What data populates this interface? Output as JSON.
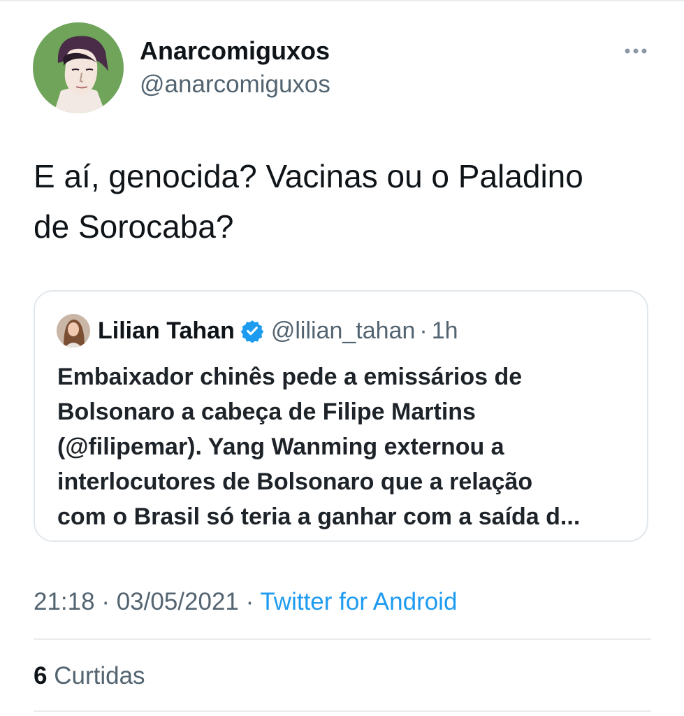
{
  "author": {
    "display_name": "Anarcomiguxos",
    "handle": "@anarcomiguxos",
    "avatar_icon": "user-avatar-icon"
  },
  "tweet": {
    "text_line1": "E aí, genocida? Vacinas ou o Paladino",
    "text_line2": "de Sorocaba?"
  },
  "quoted_tweet": {
    "display_name": "Lilian Tahan",
    "verified": true,
    "handle": "@lilian_tahan",
    "separator": "·",
    "time": "1h",
    "lines": [
      "Embaixador chinês pede a emissários de",
      "Bolsonaro a cabeça de Filipe Martins",
      "(@filipemar). Yang Wanming externou a",
      "interlocutores de Bolsonaro que a relação",
      "com o Brasil só teria a ganhar com a saída d..."
    ]
  },
  "meta": {
    "time": "21:18",
    "sep1": " · ",
    "date": "03/05/2021",
    "sep2": " · ",
    "source": "Twitter for Android"
  },
  "likes": {
    "count": "6",
    "label": "Curtidas"
  },
  "colors": {
    "accent": "#1d9bf0",
    "secondary_text": "#536471",
    "primary_text": "#0f1419",
    "border": "#e1e8ed"
  }
}
